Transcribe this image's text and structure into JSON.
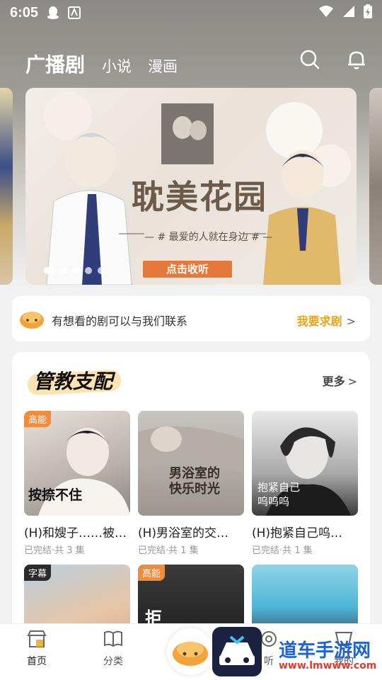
{
  "status_bar": {
    "time": "6:05"
  },
  "top_nav": {
    "tabs": [
      {
        "label": "广播剧",
        "active": true
      },
      {
        "label": "小说",
        "active": false
      },
      {
        "label": "漫画",
        "active": false
      }
    ]
  },
  "banner": {
    "title": "耽美花园",
    "subtitle": "— # 最爱的人就在身边 # —",
    "button": "点击收听",
    "slide_count": 5,
    "active_index": 0
  },
  "request": {
    "text": "有想看的剧可以与我们联系",
    "link": "我要求剧",
    "chevron": ">"
  },
  "section": {
    "title": "管教支配",
    "more": "更多",
    "more_chevron": ">",
    "items": [
      {
        "badge": "高能",
        "cover_text": "按捺不住",
        "title": "(H)和嫂子……被…",
        "meta": "已完结·共 3 集"
      },
      {
        "badge": "",
        "cover_text": "男浴室的\n快乐时光",
        "title": "(H)男浴室的交…",
        "meta": "已完结·共 1 集"
      },
      {
        "badge": "",
        "cover_text": "抱紧自己\n呜呜呜",
        "title": "(H)抱紧自己呜…",
        "meta": "已完结·共 1 集"
      },
      {
        "badge": "字幕",
        "cover_text": "",
        "title": "",
        "meta": ""
      },
      {
        "badge": "高能",
        "cover_text": "拒",
        "title": "",
        "meta": ""
      },
      {
        "badge": "",
        "cover_text": "",
        "title": "",
        "meta": ""
      }
    ]
  },
  "tabbar": {
    "items": [
      {
        "label": "首页",
        "icon": "shop-icon",
        "active": true
      },
      {
        "label": "分类",
        "icon": "book-icon",
        "active": false
      },
      {
        "label": "",
        "icon": "bun-mascot-icon",
        "active": false
      },
      {
        "label": "听",
        "icon": "headphone-icon",
        "active": false
      },
      {
        "label": "我的",
        "icon": "profile-icon",
        "active": false
      }
    ]
  },
  "watermark": {
    "text": "道车手游网",
    "url": "www.lmwww.com"
  },
  "colors": {
    "accent": "#f08c3a",
    "link": "#e8a317"
  }
}
